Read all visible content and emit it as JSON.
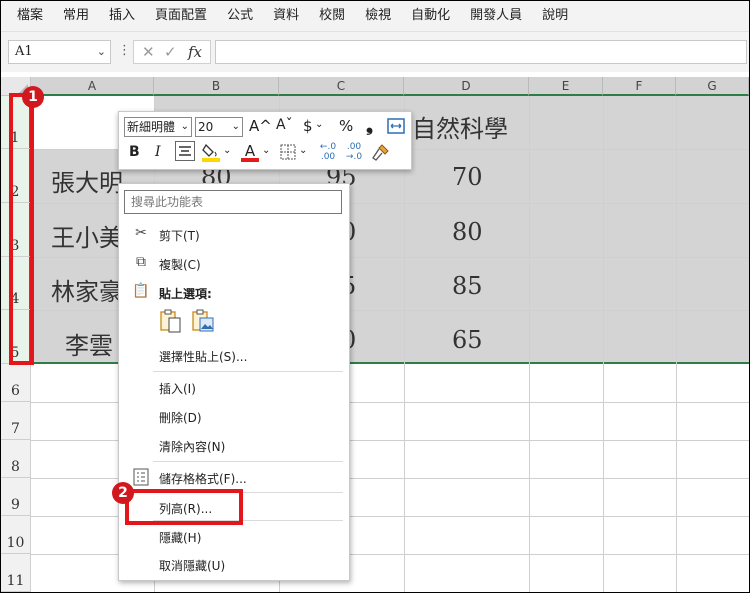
{
  "ribbon": {
    "tabs": [
      "檔案",
      "常用",
      "插入",
      "頁面配置",
      "公式",
      "資料",
      "校閱",
      "檢視",
      "自動化",
      "開發人員",
      "說明"
    ]
  },
  "formula_bar": {
    "name_box": "A1",
    "formula": ""
  },
  "columns": [
    "A",
    "B",
    "C",
    "D",
    "E",
    "F",
    "G"
  ],
  "rows": [
    "1",
    "2",
    "3",
    "4",
    "5",
    "6",
    "7",
    "8",
    "9",
    "10",
    "11"
  ],
  "cells": {
    "D1": "自然科學",
    "A2": "張大明",
    "B2": "80",
    "C2": "95",
    "D2": "70",
    "A3": "王小美",
    "C3": "0",
    "D3": "80",
    "A4": "林家豪",
    "C4": "5",
    "D4": "85",
    "A5": "李雲",
    "C5": "0",
    "D5": "65"
  },
  "mini_toolbar": {
    "font": "新細明體",
    "size": "20",
    "grow": "A^",
    "shrink": "Aˇ",
    "currency": "$",
    "percent": "%",
    "comma": "❟",
    "bold": "B",
    "italic": "I",
    "font_color": "A"
  },
  "context_menu": {
    "search_placeholder": "搜尋此功能表",
    "items": {
      "cut": "剪下(T)",
      "copy": "複製(C)",
      "paste_options": "貼上選項:",
      "paste_special": "選擇性貼上(S)...",
      "insert": "插入(I)",
      "delete": "刪除(D)",
      "clear": "清除內容(N)",
      "format_cells": "儲存格格式(F)...",
      "row_height": "列高(R)...",
      "hide": "隱藏(H)",
      "unhide": "取消隱藏(U)"
    }
  },
  "callouts": {
    "step1": "1",
    "step2": "2"
  },
  "colors": {
    "selection_border": "#2d7d46",
    "callout": "#e3161b",
    "font_color_bar": "#e31b1b",
    "fill_color_bar": "#ffd700"
  }
}
